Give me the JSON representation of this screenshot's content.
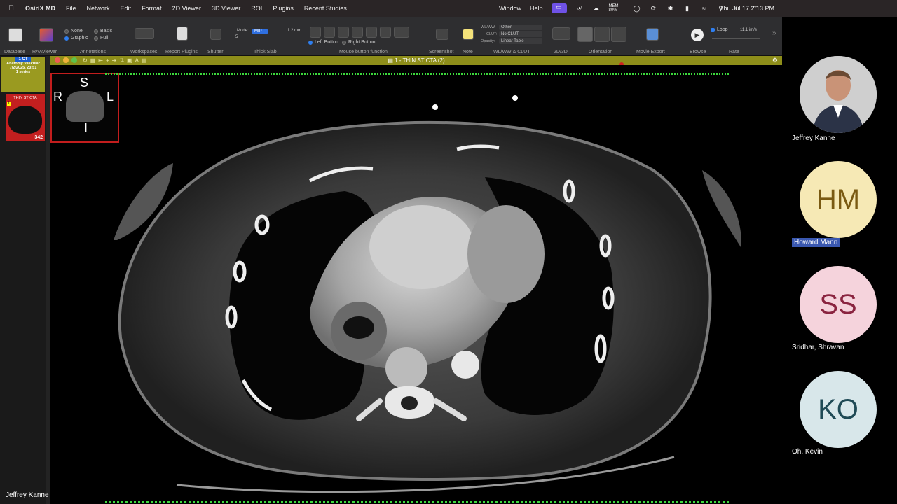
{
  "menubar": {
    "app": "OsiriX MD",
    "items": [
      "File",
      "Network",
      "Edit",
      "Format",
      "2D Viewer",
      "3D Viewer",
      "ROI",
      "Plugins",
      "Recent Studies"
    ],
    "right_items": [
      "Window",
      "Help"
    ],
    "mem_label": "MEM 80%",
    "clock": "Thu Jul 17  2:13 PM"
  },
  "toolbar": {
    "groups": {
      "database": "Database",
      "raaviewer": "RAAViewer",
      "annotations": "Annotations",
      "workspaces": "Workspaces",
      "report_plugins": "Report Plugins",
      "shutter": "Shutter",
      "thick_slab": "Thick Slab",
      "mouse_button": "Mouse button function",
      "screenshot": "Screenshot",
      "note": "Note",
      "wlww_clut": "WL/WW & CLUT",
      "2d3d": "2D/3D",
      "orientation": "Orientation",
      "movie_export": "Movie Export",
      "browse": "Browse",
      "rate": "Rate"
    },
    "annotations": {
      "none": "None",
      "graphic": "Graphic",
      "basic": "Basic",
      "full": "Full"
    },
    "thick_slab": {
      "mode_label": "Mode:",
      "mode_value": "MIP",
      "thickness": "1.2 mm",
      "count": "5"
    },
    "mouse": {
      "left": "Left Button",
      "right": "Right Button"
    },
    "wlww": {
      "wl_label": "WL/WW:",
      "wl_value": "Other",
      "clut_label": "CLUT:",
      "clut_value": "No CLUT",
      "opacity_label": "Opacity:",
      "opacity_value": "Linear Table"
    },
    "loop_label": "Loop",
    "rate_value": "11.1 im/s"
  },
  "viewer": {
    "title": "1 - THIN ST CTA (2)"
  },
  "study": {
    "count": "1 CT",
    "name": "Anatomy Vascular",
    "date": "7/2/2025, 23:51",
    "series_count": "1 series",
    "series_label": "THIN ST CTA",
    "series_num": "1",
    "images": "342"
  },
  "locator": {
    "top": "S",
    "left": "R",
    "right": "L",
    "bottom": "I"
  },
  "participants": [
    {
      "name": "Jeffrey Kanne",
      "initials": "",
      "bg": "#d8d8d8",
      "fg": "#222"
    },
    {
      "name": "Howard Mann",
      "initials": "HM",
      "bg": "#f6e9b5",
      "fg": "#7a5a12"
    },
    {
      "name": "Sridhar, Shravan",
      "initials": "SS",
      "bg": "#f5d3dc",
      "fg": "#8a2440"
    },
    {
      "name": "Oh, Kevin",
      "initials": "KO",
      "bg": "#d8e7ea",
      "fg": "#1f4a55"
    }
  ],
  "local_user": "Jeffrey Kanne"
}
